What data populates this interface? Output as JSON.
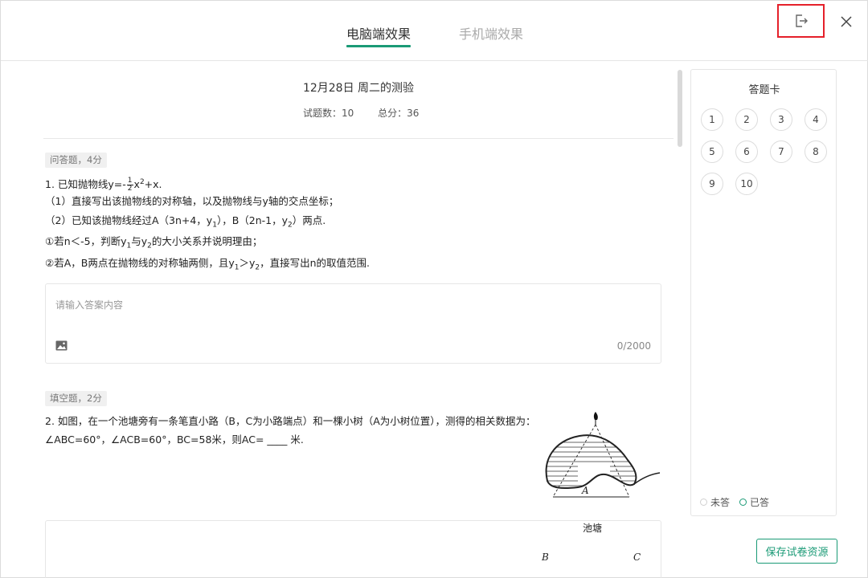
{
  "header": {
    "tabs": [
      {
        "label": "电脑端效果",
        "active": true
      },
      {
        "label": "手机端效果",
        "active": false
      }
    ],
    "exit_icon": "exit-icon",
    "close_icon": "close-icon"
  },
  "paper": {
    "title": "12月28日 周二的测验",
    "question_count_label": "试题数：10",
    "total_score_label": "总分：36"
  },
  "questions": [
    {
      "tag": "问答题，4分",
      "lines": {
        "l1_prefix": "1. 已知抛物线y=-",
        "l1_num": "1",
        "l1_den": "2",
        "l1_mid": "x",
        "l1_sup": "2",
        "l1_suffix": "+x.",
        "l2": "（1）直接写出该抛物线的对称轴，以及抛物线与y轴的交点坐标；",
        "l3_a": "（2）已知该抛物线经过A（3n+4，y",
        "l3_s1": "1",
        "l3_b": "），B（2n-1，y",
        "l3_s2": "2",
        "l3_c": "）两点.",
        "l4_a": "①若n＜-5，判断y",
        "l4_s1": "1",
        "l4_b": "与y",
        "l4_s2": "2",
        "l4_c": "的大小关系并说明理由；",
        "l5_a": "②若A，B两点在抛物线的对称轴两侧，且y",
        "l5_s1": "1",
        "l5_b": "＞y",
        "l5_s2": "2",
        "l5_c": "，直接写出n的取值范围."
      },
      "answer": {
        "placeholder": "请输入答案内容",
        "count": "0/2000",
        "image_icon": "image-icon"
      }
    },
    {
      "tag": "填空题，2分",
      "text": "2. 如图，在一个池塘旁有一条笔直小路（B，C为小路端点）和一棵小树（A为小树位置），测得的相关数据为：∠ABC=60°，∠ACB=60°，BC=58米，则AC= ____ 米.",
      "figure": {
        "pond_label": "池塘",
        "point_a": "A",
        "point_b": "B",
        "point_c": "C"
      }
    }
  ],
  "answer_card": {
    "title": "答题卡",
    "numbers": [
      "1",
      "2",
      "3",
      "4",
      "5",
      "6",
      "7",
      "8",
      "9",
      "10"
    ],
    "legend_unanswered": "未答",
    "legend_answered": "已答",
    "answered_color": "#1a9a76"
  },
  "footer": {
    "save_label": "保存试卷资源"
  },
  "colors": {
    "accent": "#1a9a76",
    "highlight_border": "#e5202a"
  }
}
